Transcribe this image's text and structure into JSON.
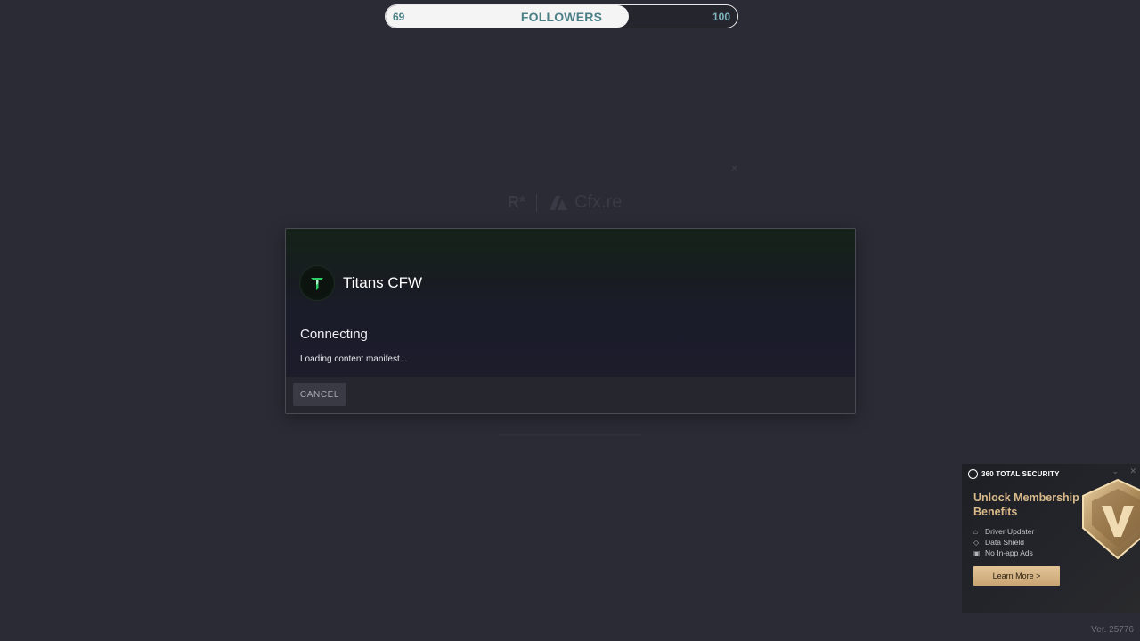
{
  "followers": {
    "current": "69",
    "label": "FOLLOWERS",
    "goal": "100",
    "progress_fraction": 0.69
  },
  "background": {
    "rockstar_logo": "R*",
    "cfx_label": "Cfx.re"
  },
  "dialog": {
    "server_name": "Titans CFW",
    "server_icon": "titans-logo-icon",
    "status_title": "Connecting",
    "status_subtitle": "Loading content manifest...",
    "cancel_label": "CANCEL"
  },
  "ad": {
    "brand": "360 TOTAL SECURITY",
    "title": "Unlock Membership Benefits",
    "features": [
      {
        "icon": "driver-icon",
        "label": "Driver Updater"
      },
      {
        "icon": "shield-icon",
        "label": "Data Shield"
      },
      {
        "icon": "no-ads-icon",
        "label": "No In-app Ads"
      }
    ],
    "cta_label": "Learn More >"
  },
  "version": "Ver. 25776",
  "colors": {
    "background": "#2b2b35",
    "accent_teal": "#4a7f86",
    "ad_gold": "#d9b98a",
    "brand_green": "#2fd06a"
  }
}
